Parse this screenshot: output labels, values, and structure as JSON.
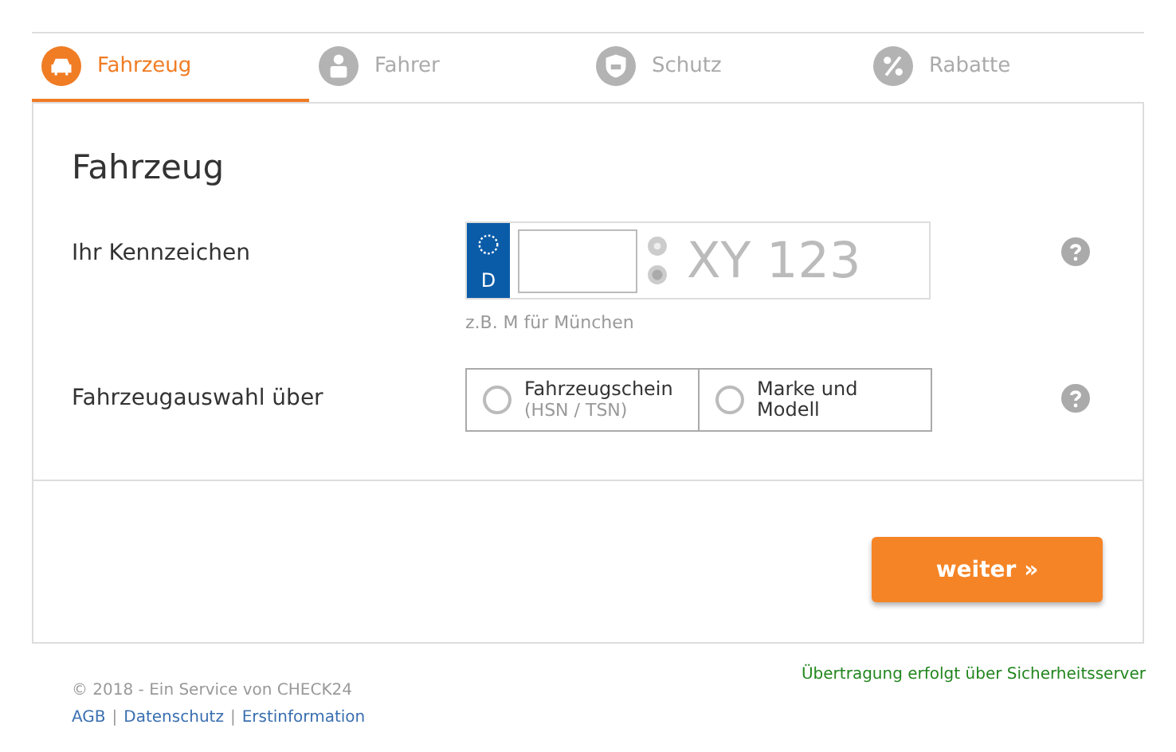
{
  "tabs": [
    {
      "label": "Fahrzeug",
      "kind": "car",
      "selected": true
    },
    {
      "label": "Fahrer",
      "kind": "person",
      "selected": false
    },
    {
      "label": "Schutz",
      "kind": "shield",
      "selected": false
    },
    {
      "label": "Rabatte",
      "kind": "percent",
      "selected": false
    }
  ],
  "form": {
    "title": "Fahrzeug",
    "plate": {
      "label": "Ihr Kennzeichen",
      "country": "D",
      "placeholder": "XY 123",
      "hint": "z.B. M für München"
    },
    "selection": {
      "label": "Fahrzeugauswahl über",
      "options": [
        {
          "label": "Fahrzeugschein",
          "sublabel": "(HSN / TSN)",
          "selected": false
        },
        {
          "label": "Marke und Modell",
          "selected": false
        }
      ]
    },
    "submit": "weiter »"
  },
  "footer": {
    "copyright": "© 2018 - Ein Service von CHECK24",
    "links": [
      "AGB",
      "Datenschutz",
      "Erstinformation"
    ],
    "separators": [
      "|",
      "|"
    ],
    "security": "Übertragung erfolgt über Sicherheitsserver"
  }
}
